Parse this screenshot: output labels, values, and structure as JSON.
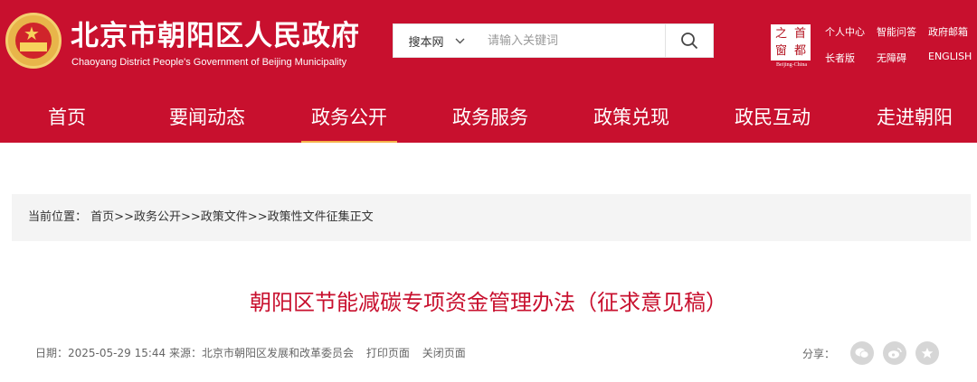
{
  "header": {
    "title": "北京市朝阳区人民政府",
    "subtitle": "Chaoyang District People's Government of Beijing Municipality",
    "capital_logo": {
      "chars": [
        "之",
        "首",
        "窗",
        "都"
      ],
      "caption": "Beijing-China"
    },
    "top_links": [
      "个人中心",
      "智能问答",
      "政府邮箱",
      "长者版",
      "无障碍",
      "ENGLISH"
    ],
    "colors": {
      "brand": "#c8102e",
      "accent": "#f5b24a"
    }
  },
  "search": {
    "scope": "搜本网",
    "placeholder": "请输入关键词",
    "button_icon": "search-icon"
  },
  "nav": {
    "items": [
      "首页",
      "要闻动态",
      "政务公开",
      "政务服务",
      "政策兑现",
      "政民互动",
      "走进朝阳"
    ],
    "active": "政务公开"
  },
  "breadcrumb": {
    "label": "当前位置：",
    "items": [
      "首页",
      "政务公开",
      "政策文件",
      "政策性文件征集正文"
    ],
    "separator": ">>"
  },
  "article": {
    "title": "朝阳区节能减碳专项资金管理办法（征求意见稿）",
    "date_label": "日期：",
    "date": "2025-05-29 15:44",
    "source_label": "来源：",
    "source": "北京市朝阳区发展和改革委员会",
    "print": "打印页面",
    "close": "关闭页面",
    "share_label": "分享："
  }
}
